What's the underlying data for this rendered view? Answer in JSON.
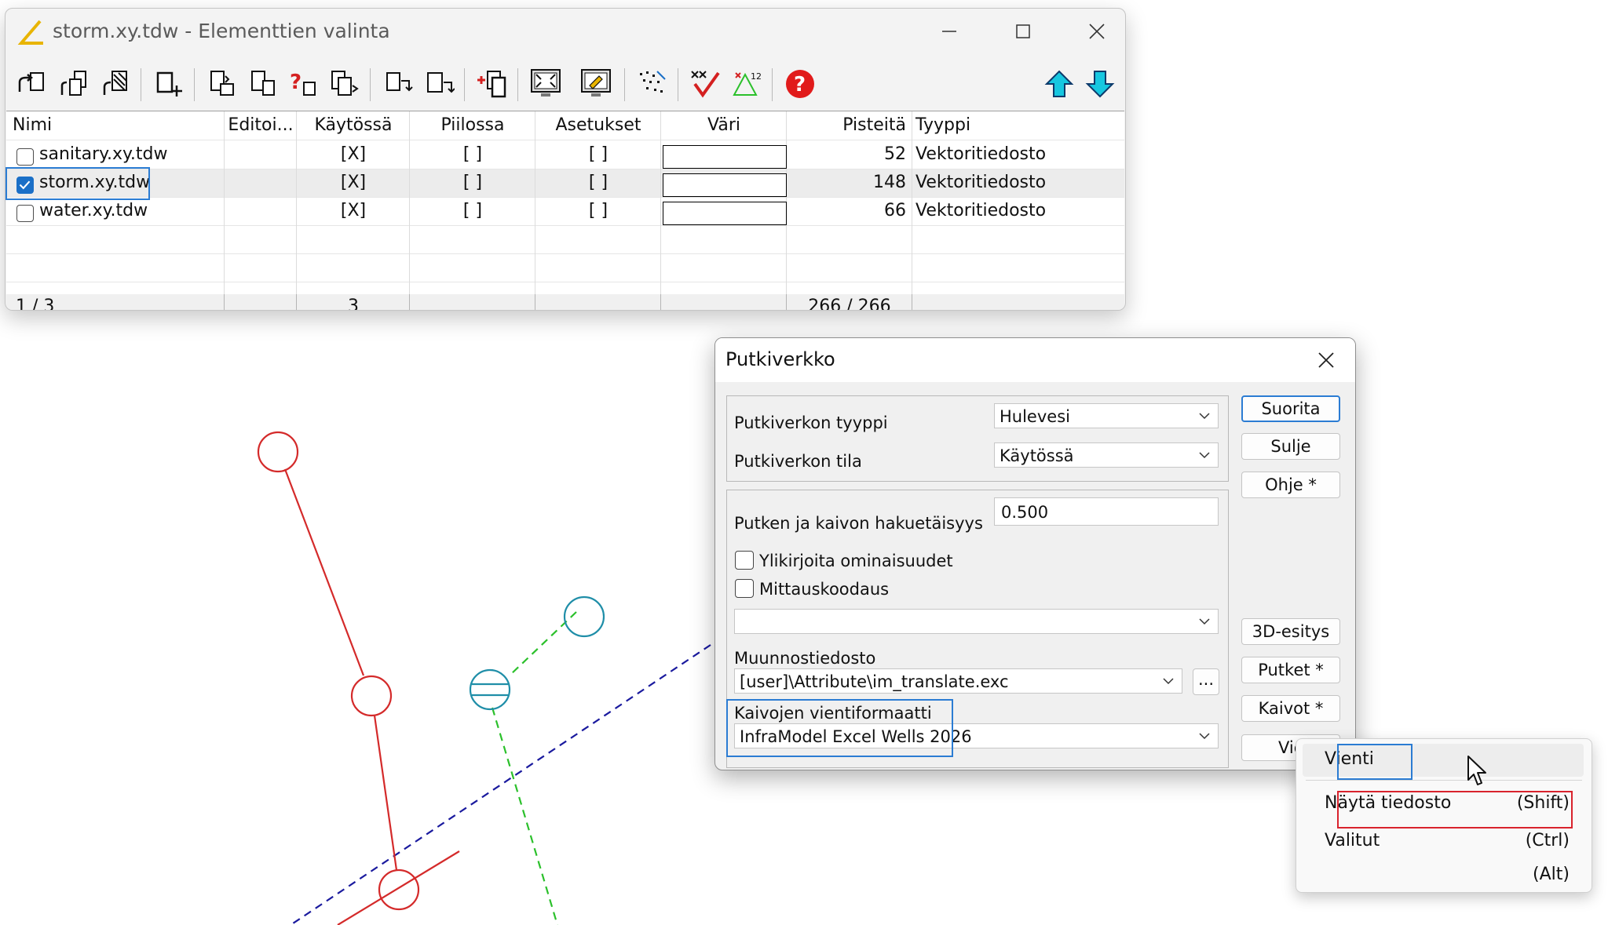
{
  "element_window": {
    "title": "storm.xy.tdw - Elementtien valinta",
    "columns": [
      "Nimi",
      "Editoi...",
      "Käytössä",
      "Piilossa",
      "Asetukset",
      "Väri",
      "Pisteitä",
      "Tyyppi"
    ],
    "rows": [
      {
        "name": "sanitary.xy.tdw",
        "checked": false,
        "kaytossa": "[X]",
        "piilossa": "[ ]",
        "asetukset": "[ ]",
        "pisteita": "52",
        "tyyppi": "Vektoritiedosto"
      },
      {
        "name": "storm.xy.tdw",
        "checked": true,
        "kaytossa": "[X]",
        "piilossa": "[ ]",
        "asetukset": "[ ]",
        "pisteita": "148",
        "tyyppi": "Vektoritiedosto"
      },
      {
        "name": "water.xy.tdw",
        "checked": false,
        "kaytossa": "[X]",
        "piilossa": "[ ]",
        "asetukset": "[ ]",
        "pisteita": "66",
        "tyyppi": "Vektoritiedosto"
      }
    ],
    "status": {
      "position": "1 / 3",
      "kaytossa_count": "3",
      "points": "266 / 266"
    }
  },
  "dialog": {
    "title": "Putkiverkko",
    "network_type_label": "Putkiverkon tyyppi",
    "network_type_value": "Hulevesi",
    "network_state_label": "Putkiverkon tila",
    "network_state_value": "Käytössä",
    "search_distance_label": "Putken ja kaivon hakuetäisyys",
    "search_distance_value": "0.500",
    "overwrite_label": "Ylikirjoita ominaisuudet",
    "survey_coding_label": "Mittauskoodaus",
    "translation_label": "Muunnostiedosto",
    "translation_value": "[user]\\Attribute\\im_translate.exc",
    "browse_label": "...",
    "well_format_label": "Kaivojen vientiformaatti",
    "well_format_value": "InfraModel Excel Wells 2026",
    "buttons": {
      "suorita": "Suorita",
      "sulje": "Sulje",
      "ohje": "Ohje *",
      "esitys3d": "3D-esitys",
      "putket": "Putket *",
      "kaivot": "Kaivot *",
      "vienti": "Vienti"
    }
  },
  "context_menu": {
    "items": [
      {
        "label": "Vienti",
        "shortcut": ""
      },
      {
        "label": "Näytä tiedosto",
        "shortcut": "(Shift)"
      },
      {
        "label": "Valitut",
        "shortcut": "(Ctrl)"
      },
      {
        "label": "",
        "shortcut": "(Alt)"
      }
    ]
  },
  "colors": {
    "storm_network": "#d42a2a",
    "water_network": "#1f8ea8",
    "sanitary_network": "#2bc02b",
    "boundary_line": "#1a1a9e",
    "focus_blue": "#2b7cd3",
    "highlight_red": "#d9232d"
  }
}
